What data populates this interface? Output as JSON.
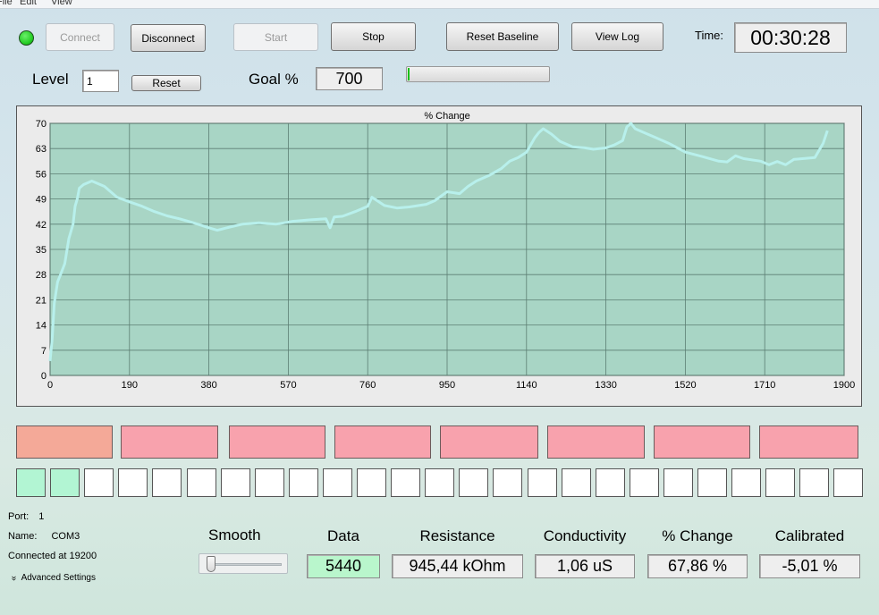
{
  "menu": [
    "File",
    "Edit",
    "View"
  ],
  "connection_led": {
    "color": "#22cc22"
  },
  "toolbar": {
    "connect": "Connect",
    "disconnect": "Disconnect",
    "start": "Start",
    "stop": "Stop",
    "reset_baseline": "Reset Baseline",
    "view_log": "View Log",
    "time_label": "Time:",
    "time_value": "00:30:28"
  },
  "level": {
    "label": "Level",
    "value": "1",
    "reset": "Reset"
  },
  "goal": {
    "label": "Goal %",
    "value": "700",
    "progress_fraction": 0.01
  },
  "chart_data": {
    "type": "line",
    "title": "% Change",
    "xlim": [
      0,
      1900
    ],
    "ylim": [
      0,
      70
    ],
    "xticks": [
      0,
      190,
      380,
      570,
      760,
      950,
      1140,
      1330,
      1520,
      1710,
      1900
    ],
    "yticks": [
      0,
      7,
      14,
      21,
      28,
      35,
      42,
      49,
      56,
      63,
      70
    ],
    "grid": true,
    "line_color": "#b8f0ec",
    "background": "#a8d5c5",
    "x": [
      0,
      5,
      10,
      18,
      25,
      35,
      45,
      55,
      60,
      65,
      70,
      80,
      90,
      100,
      110,
      120,
      130,
      140,
      160,
      190,
      220,
      250,
      280,
      310,
      340,
      380,
      400,
      410,
      430,
      460,
      500,
      540,
      580,
      620,
      660,
      670,
      680,
      700,
      730,
      760,
      770,
      800,
      830,
      860,
      900,
      920,
      950,
      980,
      1000,
      1020,
      1050,
      1080,
      1100,
      1120,
      1140,
      1160,
      1170,
      1180,
      1200,
      1220,
      1250,
      1280,
      1300,
      1330,
      1350,
      1370,
      1380,
      1390,
      1400,
      1420,
      1450,
      1480,
      1520,
      1560,
      1600,
      1620,
      1640,
      1660,
      1700,
      1720,
      1740,
      1760,
      1780,
      1800,
      1830,
      1850,
      1860
    ],
    "y": [
      4,
      10,
      20,
      26,
      28,
      31,
      38,
      42,
      47,
      49,
      52,
      53,
      53.5,
      54,
      53.5,
      53,
      52.5,
      51.5,
      49.5,
      48.2,
      47,
      45.5,
      44.3,
      43.5,
      42.5,
      41,
      40.3,
      40.6,
      41.2,
      42,
      42.4,
      42,
      42.8,
      43.2,
      43.5,
      41,
      44,
      44.2,
      45.5,
      47,
      49.5,
      47.2,
      46.5,
      46.8,
      47.5,
      48.5,
      51,
      50.5,
      52.5,
      54,
      55.5,
      57.5,
      59.5,
      60.5,
      62,
      66,
      67.5,
      68.5,
      67,
      65,
      63.5,
      63.2,
      62.8,
      63.2,
      64,
      65.2,
      69,
      70,
      68.5,
      67.5,
      66,
      64.5,
      62,
      60.8,
      59.5,
      59.3,
      61,
      60.2,
      59.5,
      58.5,
      59.4,
      58.5,
      60,
      60.2,
      60.5,
      64.5,
      68
    ]
  },
  "status_blocks": [
    {
      "color": "#f4a998"
    },
    {
      "color": "#f8a2ad"
    },
    {
      "color": "#f8a2ad"
    },
    {
      "color": "#f8a2ad"
    },
    {
      "color": "#f8a2ad"
    },
    {
      "color": "#f8a2ad"
    },
    {
      "color": "#f8a2ad"
    },
    {
      "color": "#f8a2ad"
    }
  ],
  "indicators": {
    "count": 25,
    "active": 2,
    "active_color": "#b2f5d3",
    "inactive_color": "#ffffff"
  },
  "port_info": {
    "port_label": "Port:",
    "port_value": "1",
    "name_label": "Name:",
    "name_value": "COM3",
    "connected": "Connected at 19200",
    "advanced": "Advanced Settings"
  },
  "smooth": {
    "label": "Smooth",
    "value_fraction": 0.0
  },
  "readouts": [
    {
      "label": "Data",
      "value": "5440",
      "bg": "#b9f6cc"
    },
    {
      "label": "Resistance",
      "value": "945,44 kOhm",
      "bg": "#eeeeee"
    },
    {
      "label": "Conductivity",
      "value": "1,06 uS",
      "bg": "#eeeeee"
    },
    {
      "label": "% Change",
      "value": "67,86 %",
      "bg": "#eeeeee"
    },
    {
      "label": "Calibrated",
      "value": "-5,01 %",
      "bg": "#eeeeee"
    }
  ]
}
